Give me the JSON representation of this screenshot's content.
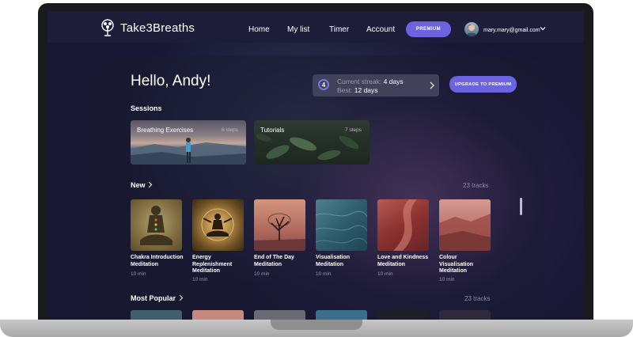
{
  "nav": {
    "brand": "Take3Breaths",
    "links": [
      "Home",
      "My list",
      "Timer",
      "Account"
    ],
    "premium_label": "PREMIUM",
    "email": "mary.mary@gmail.com"
  },
  "main": {
    "greeting": "Hello, Andy!",
    "streak": {
      "number": "4",
      "current_label": "Current streak:",
      "current_value": "4 days",
      "best_label": "Best:",
      "best_value": "12 days"
    },
    "upgrade_label": "UPGRADE TO PREMIUM",
    "sessions": {
      "title": "Sessions",
      "items": [
        {
          "name": "Breathing Exercises",
          "steps": "6 steps"
        },
        {
          "name": "Tutorials",
          "steps": "7 steps"
        }
      ]
    },
    "new": {
      "title": "New",
      "count": "23 tracks",
      "tracks": [
        {
          "title": "Chakra Introduction Meditation",
          "duration": "10 min"
        },
        {
          "title": "Energy Replenishment Meditation",
          "duration": "10 min"
        },
        {
          "title": "End of The Day Meditation",
          "duration": "10 min"
        },
        {
          "title": "Visualisation Meditation",
          "duration": "10 min"
        },
        {
          "title": "Love and Kindness Meditation",
          "duration": "10 min"
        },
        {
          "title": "Colour Visualisation Meditation",
          "duration": "10 min"
        }
      ]
    },
    "popular": {
      "title": "Most Popular",
      "count": "23 tracks"
    }
  },
  "colors": {
    "accent": "#6c63e0",
    "background": "#171733",
    "nav_background": "#1d1d3a"
  },
  "icons": {
    "logo": "lotus-tree-icon",
    "chevron": "chevron-right-icon",
    "dropdown": "chevron-down-icon"
  }
}
